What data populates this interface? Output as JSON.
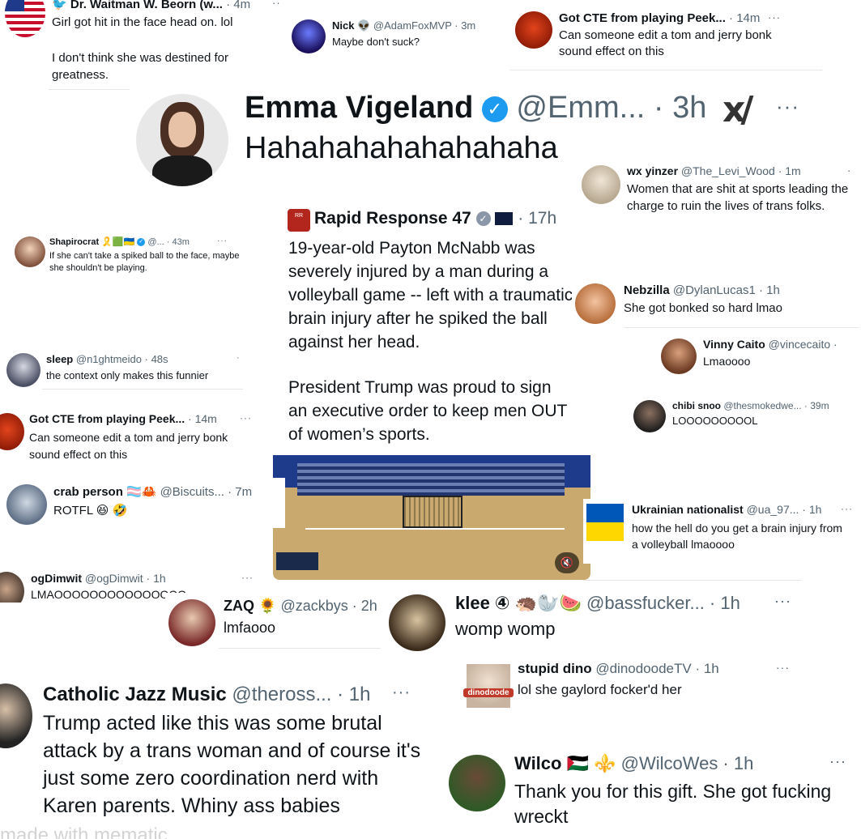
{
  "colors": {
    "accent": "#1d9bf0",
    "text": "#0f1419",
    "muted": "#536471",
    "court_floor": "#c9a96e",
    "court_wall": "#1e3a8a"
  },
  "posts": {
    "waitman": {
      "name": "Dr. Waitman W. Beorn (w...",
      "time": "· 4m",
      "text1": "Girl got hit in the face head on. lol",
      "text2": "I don't think she was destined for greatness.",
      "icon": "twitter-bird-icon"
    },
    "nick": {
      "name": "Nick 👽",
      "handle": "@AdamFoxMVP · 3m",
      "text": "Maybe don't suck?"
    },
    "cte_top": {
      "name": "Got CTE from playing Peek...",
      "time": "· 14m",
      "text": "Can someone edit a tom and jerry bonk sound effect on this"
    },
    "emma": {
      "name": "Emma Vigeland",
      "handle": "@Emm... · 3h",
      "text": "Hahahahahahahahaha",
      "logo": "xai-logo-icon"
    },
    "wx": {
      "name": "wx yinzer",
      "handle": "@The_Levi_Wood · 1m",
      "text": "Women that are shit at sports leading the charge to ruin the lives of trans folks."
    },
    "rapid": {
      "name": "Rapid Response 47",
      "time": "· 17h",
      "p1": "19-year-old Payton McNabb was severely injured by a man during a volleyball game -- left with a traumatic brain injury after he spiked the ball against her head.",
      "p2": "President Trump was proud to sign an executive order to keep men OUT of women’s sports.",
      "mute": "mute-icon"
    },
    "shapiro": {
      "name": "Shapirocrat 🎗️🟩🇺🇦",
      "handle": "@... · 43m",
      "text": "If she can't take a spiked ball to the face, maybe she shouldn't be playing."
    },
    "nebzilla": {
      "name": "Nebzilla",
      "handle": "@DylanLucas1 · 1h",
      "text": "She got bonked so hard lmao"
    },
    "vinny": {
      "name": "Vinny Caito",
      "handle": "@vincecaito ·",
      "text": "Lmaoooo"
    },
    "sleep": {
      "name": "sleep",
      "handle": "@n1ghtmeido · 48s",
      "text": "the context only makes this funnier"
    },
    "chibi": {
      "name": "chibi snoo",
      "handle": "@thesmokedwe... · 39m",
      "text": "LOOOOOOOOOL"
    },
    "cte_mid": {
      "name": "Got CTE from playing Peek...",
      "time": "· 14m",
      "text": "Can someone edit a tom and jerry bonk sound effect on this"
    },
    "crab": {
      "name": "crab person 🏳️‍⚧️🦀",
      "handle": "@Biscuits... · 7m",
      "text": "ROTFL 😆 🤣"
    },
    "ukr": {
      "name": "Ukrainian nationalist",
      "handle": "@ua_97... · 1h",
      "text": "how the hell do you get a brain injury from a volleyball lmaoooo"
    },
    "ogdim": {
      "name": "ogDimwit",
      "handle": "@ogDimwit · 1h",
      "text": "LMAOOOOOOOOOOOOOOO"
    },
    "zaq": {
      "name": "ZAQ 🌻",
      "handle": "@zackbys · 2h",
      "text": "lmfaooo"
    },
    "klee": {
      "name": "klee ④ 🦔🦭🍉",
      "handle": "@bassfucker... · 1h",
      "text": "womp womp"
    },
    "dino": {
      "name": "stupid dino",
      "handle": "@dinodoodeTV · 1h",
      "text": "lol she gaylord focker'd her",
      "badge": "dinodoode"
    },
    "catholic": {
      "name": "Catholic Jazz Music",
      "handle": "@theross... · 1h",
      "text": "Trump acted like this was some brutal attack by a trans woman and of course it's just some zero coordination nerd with Karen parents. Whiny ass babies"
    },
    "wilco": {
      "name": "Wilco 🇵🇸 ⚜️",
      "handle": "@WilcoWes · 1h",
      "text": "Thank you for this gift. She got fucking wreckt"
    },
    "watermark": "made with mematic"
  }
}
